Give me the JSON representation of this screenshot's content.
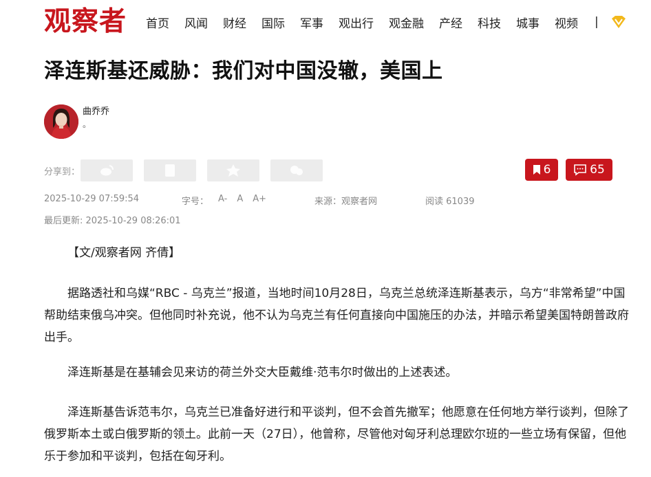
{
  "site": {
    "logo": "观察者"
  },
  "nav": {
    "items": [
      "首页",
      "风闻",
      "财经",
      "国际",
      "军事",
      "观出行",
      "观金融",
      "产经",
      "科技",
      "城事",
      "视频"
    ],
    "separator": "|"
  },
  "article": {
    "title": "泽连斯基还威胁：我们对中国没辙，美国上",
    "author": {
      "name": "曲乔乔",
      "note": "。"
    },
    "share_label": "分享到：",
    "bookmark_count": "6",
    "comment_count": "65",
    "published": "2025-10-29 07:59:54",
    "font_label": "字号：",
    "font_sizes": [
      "A-",
      "A",
      "A+"
    ],
    "source": "来源：观察者网",
    "views": "阅读 61039",
    "updated": "最后更新: 2025-10-29 08:26:01",
    "byline": "【文/观察者网 齐倩】",
    "paragraphs": [
      "据路透社和乌媒“RBC - 乌克兰”报道，当地时间10月28日，乌克兰总统泽连斯基表示，乌方“非常希望”中国帮助结束俄乌冲突。但他同时补充说，他不认为乌克兰有任何直接向中国施压的办法，并暗示希望美国特朗普政府出手。",
      "泽连斯基是在基辅会见来访的荷兰外交大臣戴维·范韦尔时做出的上述表述。",
      "泽连斯基告诉范韦尔，乌克兰已准备好进行和平谈判，但不会首先撤军；他愿意在任何地方举行谈判，但除了俄罗斯本土或白俄罗斯的领土。此前一天（27日），他曾称，尽管他对匈牙利总理欧尔班的一些立场有保留，但他乐于参加和平谈判，包括在匈牙利。"
    ]
  },
  "colors": {
    "brand": "#c8161d",
    "meta": "#888888",
    "share_bg": "#ececec"
  },
  "icons": [
    "weibo-icon",
    "wechat-icon",
    "qzone-icon",
    "douban-icon",
    "bookmark-icon",
    "comment-icon",
    "vip-badge-icon"
  ]
}
